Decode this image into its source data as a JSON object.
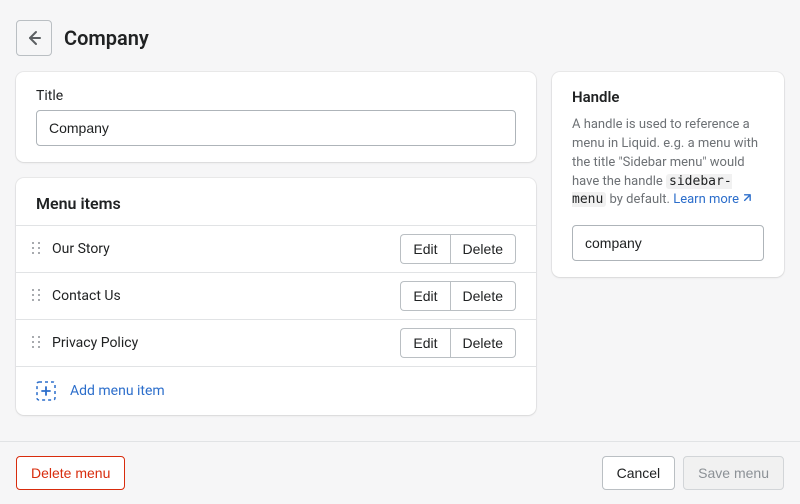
{
  "header": {
    "title": "Company"
  },
  "titleCard": {
    "label": "Title",
    "value": "Company"
  },
  "menuItems": {
    "section_title": "Menu items",
    "edit_label": "Edit",
    "delete_label": "Delete",
    "add_label": "Add menu item",
    "items": [
      {
        "label": "Our Story"
      },
      {
        "label": "Contact Us"
      },
      {
        "label": "Privacy Policy"
      }
    ]
  },
  "handle": {
    "title": "Handle",
    "desc1": "A handle is used to reference a menu in Liquid. e.g. a menu with the title \"Sidebar menu\" would have the handle ",
    "code": "sidebar-menu",
    "desc2": " by default. ",
    "learn_more": "Learn more",
    "value": "company"
  },
  "footer": {
    "delete_menu": "Delete menu",
    "cancel": "Cancel",
    "save": "Save menu"
  }
}
